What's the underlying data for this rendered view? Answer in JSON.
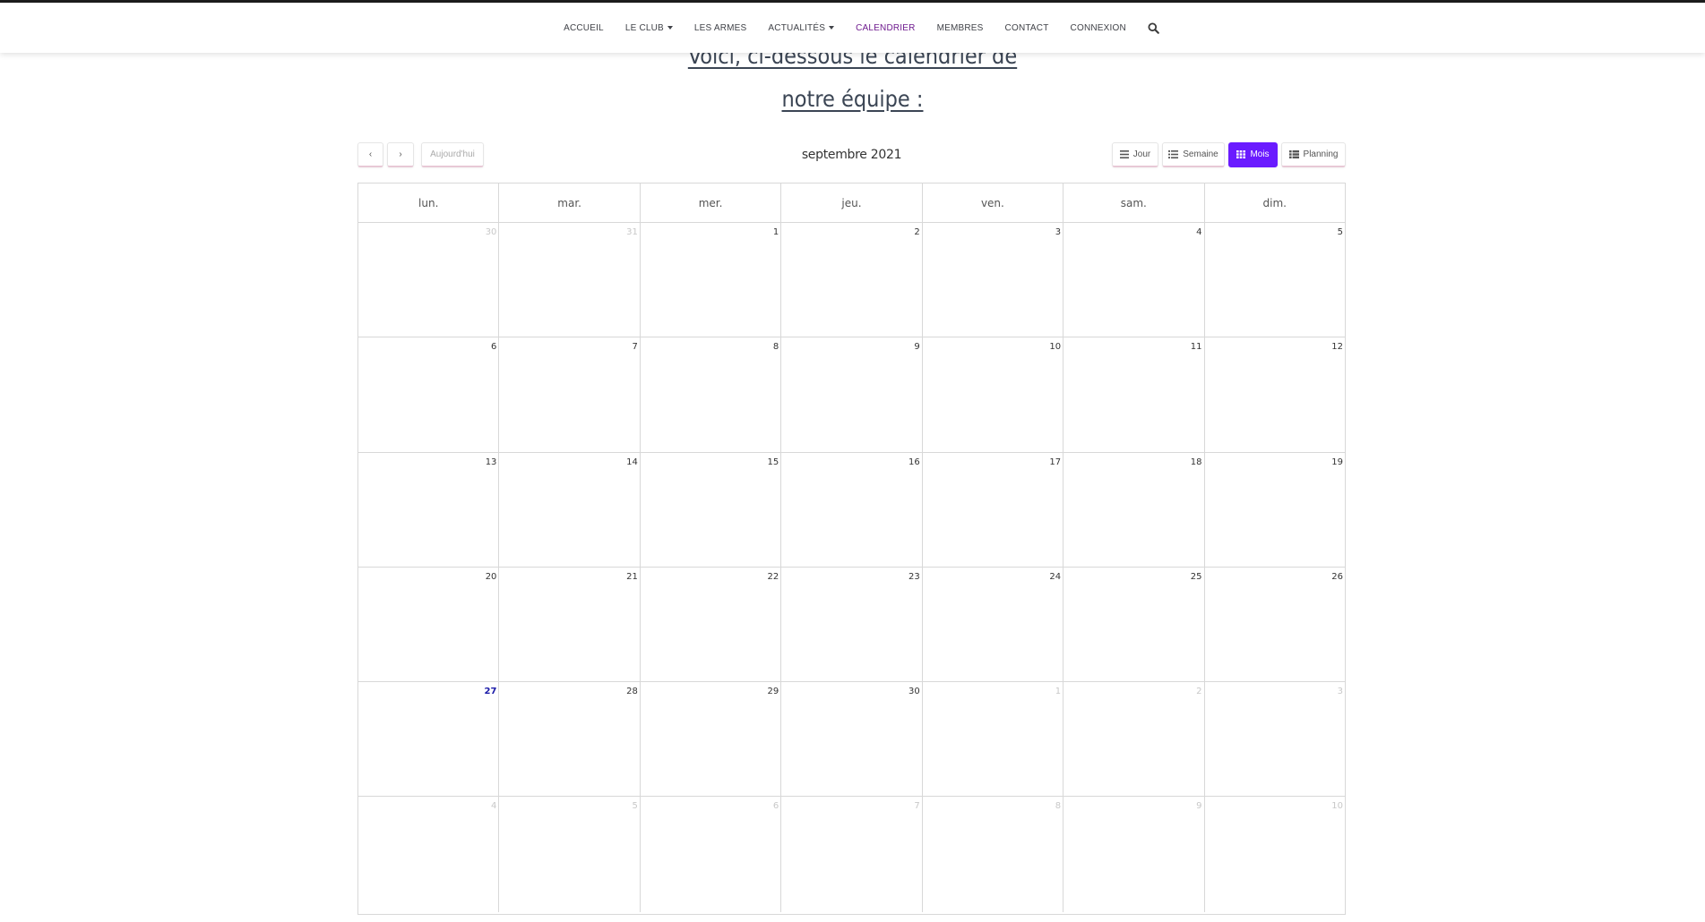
{
  "nav": {
    "items": [
      {
        "label": "ACCUEIL",
        "dropdown": false,
        "active": false
      },
      {
        "label": "LE CLUB",
        "dropdown": true,
        "active": false
      },
      {
        "label": "LES ARMES",
        "dropdown": false,
        "active": false
      },
      {
        "label": "ACTUALITÉS",
        "dropdown": true,
        "active": false
      },
      {
        "label": "CALENDRIER",
        "dropdown": false,
        "active": true
      },
      {
        "label": "MEMBRES",
        "dropdown": false,
        "active": false
      },
      {
        "label": "CONTACT",
        "dropdown": false,
        "active": false
      },
      {
        "label": "CONNEXION",
        "dropdown": false,
        "active": false
      }
    ],
    "search_icon": "search-icon",
    "active_color": "#6f1b8f"
  },
  "heading": {
    "line1": "Voici, ci-dessous le calendrier de",
    "line2": "notre équipe :"
  },
  "toolbar": {
    "prev_label": "‹",
    "next_label": "›",
    "today_label": "Aujourd'hui",
    "title": "septembre 2021",
    "views": [
      {
        "label": "Jour",
        "icon": "list-icon",
        "active": false
      },
      {
        "label": "Semaine",
        "icon": "list-bullets-icon",
        "active": false
      },
      {
        "label": "Mois",
        "icon": "grid-icon",
        "active": true
      },
      {
        "label": "Planning",
        "icon": "table-list-icon",
        "active": false
      }
    ],
    "active_color": "#6a1bff"
  },
  "calendar": {
    "weekdays": [
      "lun.",
      "mar.",
      "mer.",
      "jeu.",
      "ven.",
      "sam.",
      "dim."
    ],
    "weeks": [
      [
        {
          "d": "30",
          "other": true
        },
        {
          "d": "31",
          "other": true
        },
        {
          "d": "1"
        },
        {
          "d": "2"
        },
        {
          "d": "3"
        },
        {
          "d": "4"
        },
        {
          "d": "5"
        }
      ],
      [
        {
          "d": "6"
        },
        {
          "d": "7"
        },
        {
          "d": "8"
        },
        {
          "d": "9"
        },
        {
          "d": "10"
        },
        {
          "d": "11"
        },
        {
          "d": "12"
        }
      ],
      [
        {
          "d": "13"
        },
        {
          "d": "14"
        },
        {
          "d": "15"
        },
        {
          "d": "16"
        },
        {
          "d": "17"
        },
        {
          "d": "18"
        },
        {
          "d": "19"
        }
      ],
      [
        {
          "d": "20"
        },
        {
          "d": "21"
        },
        {
          "d": "22"
        },
        {
          "d": "23"
        },
        {
          "d": "24"
        },
        {
          "d": "25"
        },
        {
          "d": "26"
        }
      ],
      [
        {
          "d": "27",
          "today": true
        },
        {
          "d": "28"
        },
        {
          "d": "29"
        },
        {
          "d": "30"
        },
        {
          "d": "1",
          "other": true
        },
        {
          "d": "2",
          "other": true
        },
        {
          "d": "3",
          "other": true
        }
      ],
      [
        {
          "d": "4",
          "other": true
        },
        {
          "d": "5",
          "other": true
        },
        {
          "d": "6",
          "other": true
        },
        {
          "d": "7",
          "other": true
        },
        {
          "d": "8",
          "other": true
        },
        {
          "d": "9",
          "other": true
        },
        {
          "d": "10",
          "other": true
        }
      ]
    ]
  }
}
